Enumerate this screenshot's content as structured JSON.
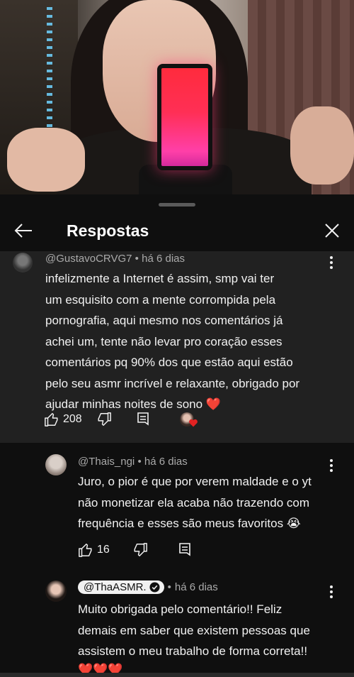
{
  "panel": {
    "title": "Respostas"
  },
  "replies": [
    {
      "author": "@GustavoCRVG7",
      "time": "há 6 dias",
      "lines": [
        "infelizmente a Internet é assim, smp vai ter",
        "um esquisito com a mente corrompida pela",
        "pornografia, aqui mesmo nos comentários já",
        "achei um, tente não levar pro coração esses",
        "comentários pq 90% dos que estão aqui estão",
        "pelo seu asmr incrível e relaxante, obrigado por",
        "ajudar minhas noites de sono ❤️"
      ],
      "likes": "208",
      "hearted": true
    },
    {
      "author": "@Thais_ngi",
      "time": "há 6 dias",
      "lines": [
        "Juro, o pior é que por verem maldade e o yt",
        "não monetizar ela acaba não trazendo com",
        "frequência e esses são meus favoritos 😭"
      ],
      "likes": "16"
    },
    {
      "author": "@ThaASMR.",
      "time": "há 6 dias",
      "verified": true,
      "lines": [
        "Muito obrigada pelo comentário!! Feliz",
        "demais em saber que existem pessoas que",
        "assistem o meu trabalho de forma correta!!",
        "❤️❤️❤️"
      ]
    }
  ],
  "separator": "•",
  "icons": [
    "back-arrow-icon",
    "close-icon",
    "more-vert-icon",
    "thumb-up-icon",
    "thumb-down-icon",
    "reply-icon",
    "heart-icon",
    "verified-check-icon"
  ],
  "colors": {
    "background": "#0f0f0f",
    "highlight": "#212121",
    "meta": "#aaaaaa",
    "heart": "#e22222"
  }
}
